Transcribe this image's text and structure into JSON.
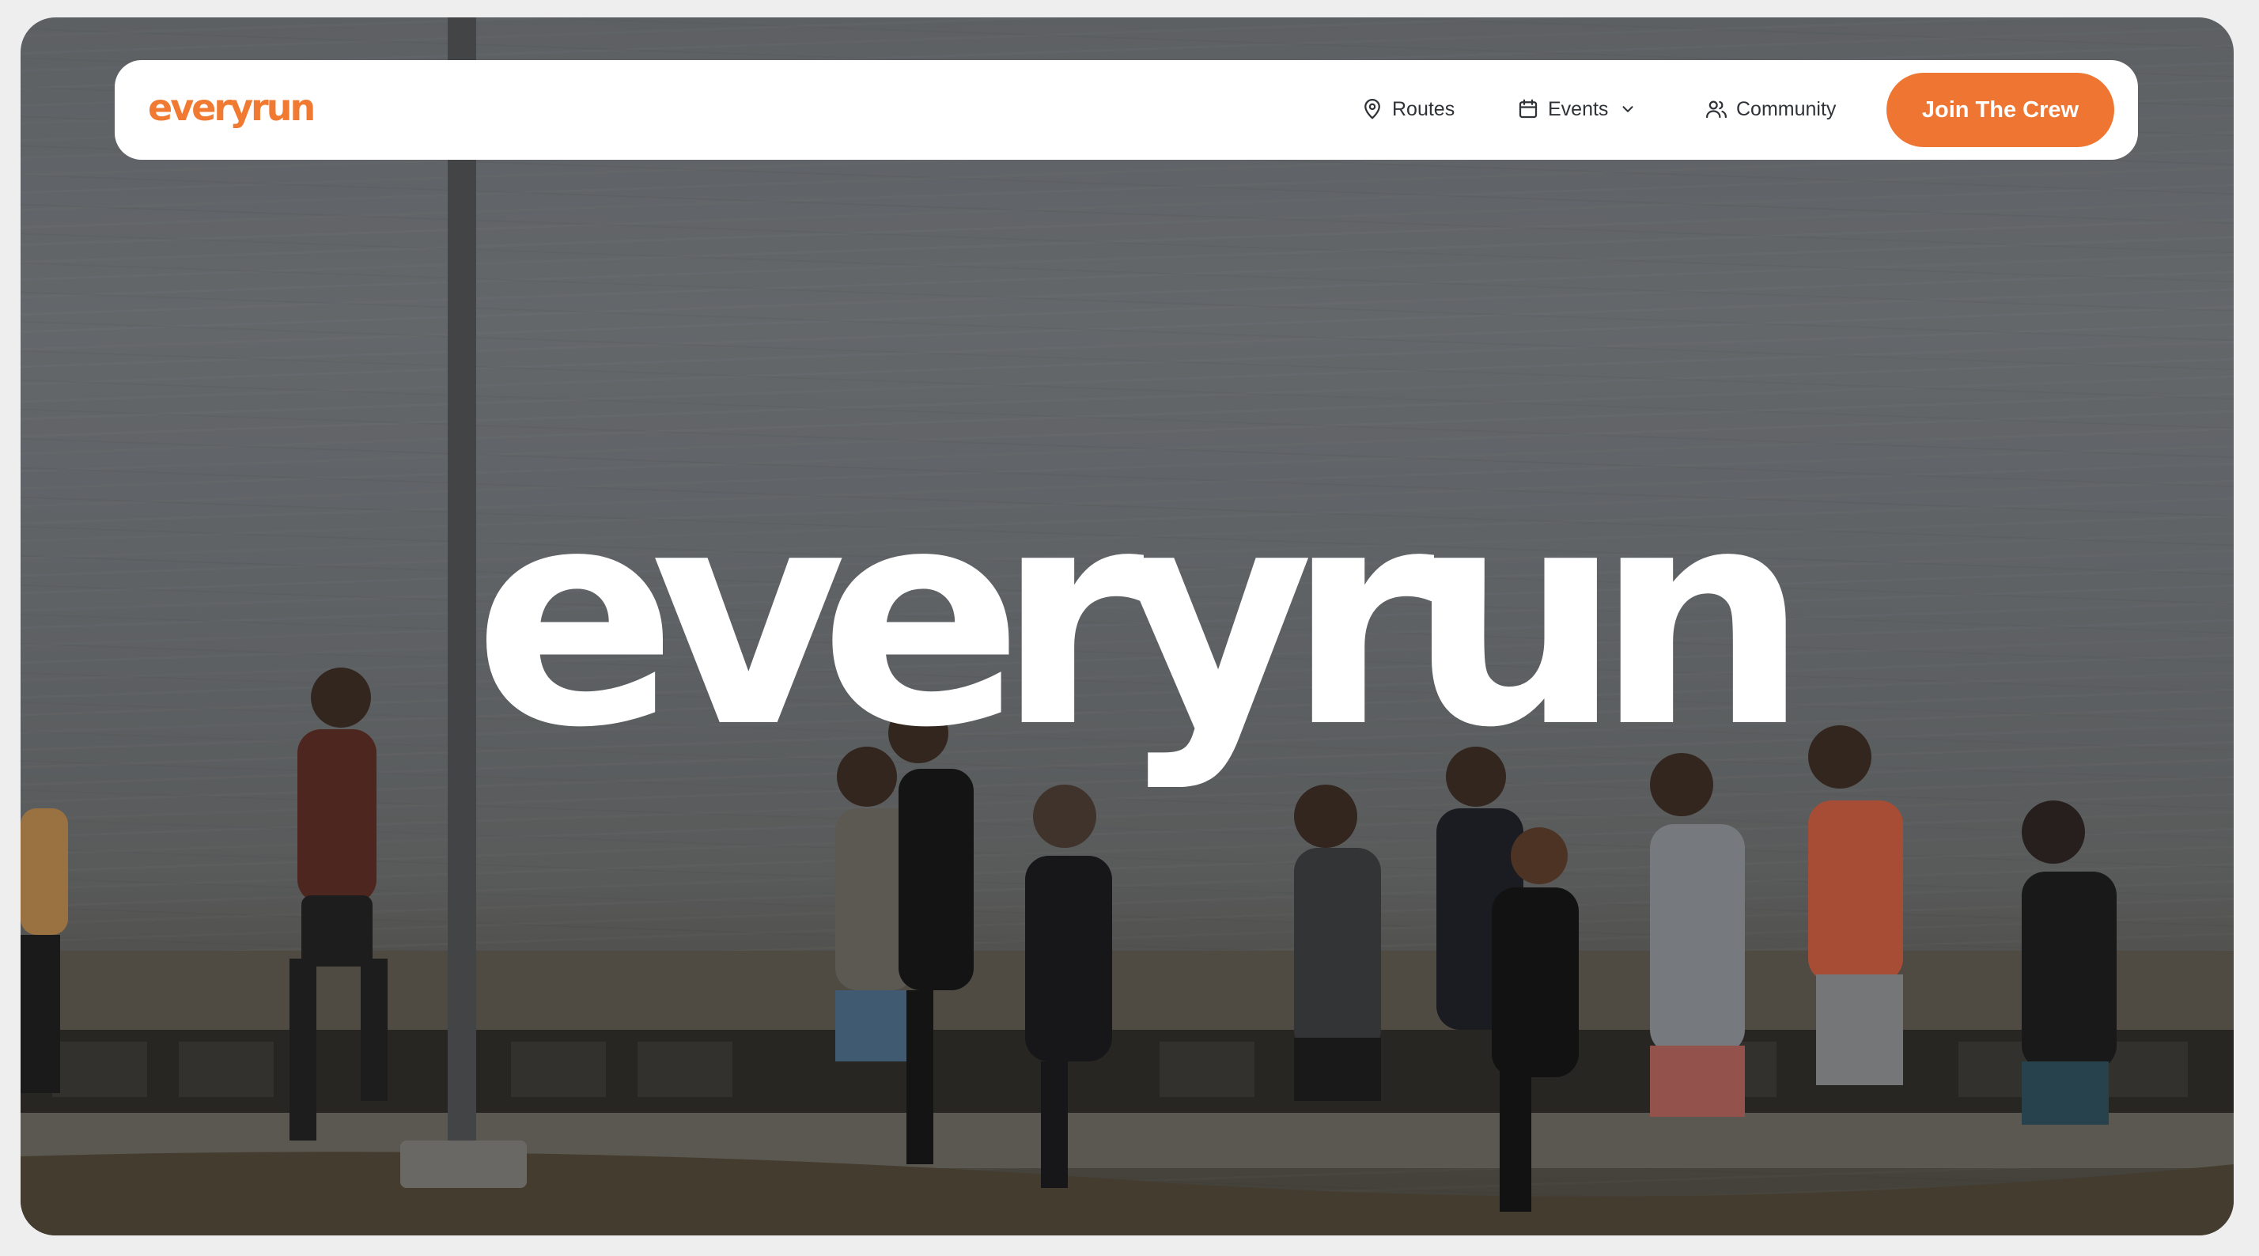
{
  "brand": {
    "logo_text": "everyrun",
    "accent_color": "#ee7532"
  },
  "nav": {
    "items": [
      {
        "label": "Routes",
        "icon": "map-pin-icon"
      },
      {
        "label": "Events",
        "icon": "calendar-icon",
        "has_dropdown": true
      },
      {
        "label": "Community",
        "icon": "users-icon"
      }
    ],
    "cta_label": "Join The Crew"
  },
  "hero": {
    "headline": "everyrun",
    "background": "photo of a group of runners jogging along a seaside path",
    "background_subject": "runners-group-photo"
  }
}
